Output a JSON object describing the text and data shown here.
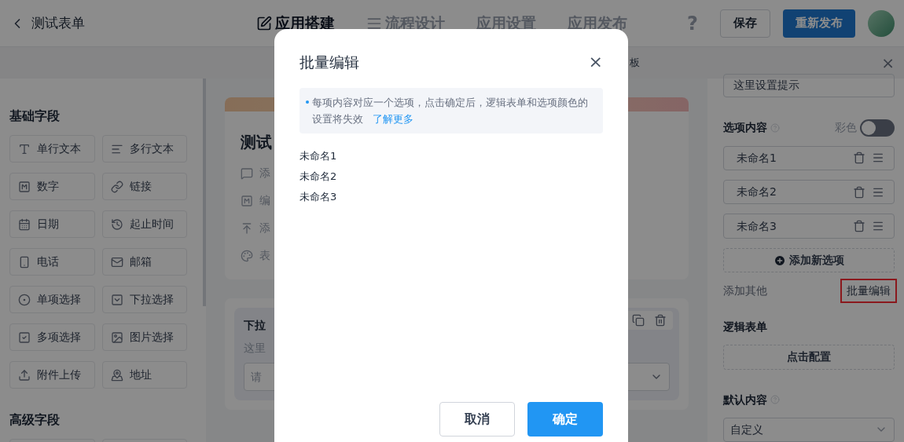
{
  "header": {
    "back_title": "测试表单",
    "tabs": [
      {
        "label": "应用搭建",
        "selected": true
      },
      {
        "label": "流程设计",
        "selected": false
      },
      {
        "label": "应用设置",
        "selected": false
      },
      {
        "label": "应用发布",
        "selected": false
      }
    ],
    "help": "?",
    "save": "保存",
    "publish": "重新发布"
  },
  "subbar": {
    "text": "板",
    "close": "×"
  },
  "left_panel": {
    "sections": [
      {
        "title": "基础字段",
        "fields": [
          "单行文本",
          "多行文本",
          "数字",
          "链接",
          "日期",
          "起止时间",
          "电话",
          "邮箱",
          "单项选择",
          "下拉选择",
          "多项选择",
          "图片选择",
          "附件上传",
          "地址"
        ]
      },
      {
        "title": "高级字段"
      }
    ]
  },
  "canvas": {
    "form_title": "测试",
    "form_items": [
      "添",
      "编",
      "添",
      "表"
    ],
    "field_card": {
      "label": "下拉",
      "hint": "这里",
      "placeholder": "请"
    }
  },
  "right_panel": {
    "hint_value": "这里设置提示",
    "options_label": "选项内容",
    "color_label": "彩色",
    "color_on": false,
    "options": [
      "未命名1",
      "未命名2",
      "未命名3"
    ],
    "add_option": "添加新选项",
    "add_other": "添加其他",
    "batch_edit": "批量编辑",
    "logic_label": "逻辑表单",
    "configure": "点击配置",
    "default_label": "默认内容",
    "default_value": "自定义"
  },
  "dialog": {
    "title": "批量编辑",
    "close": "×",
    "notice": "每项内容对应一个选项，点击确定后，逻辑表单和选项颜色的设置将失效",
    "learn_more": "了解更多",
    "lines": [
      "未命名1",
      "未命名2",
      "未命名3"
    ],
    "cancel": "取消",
    "confirm": "确定"
  }
}
